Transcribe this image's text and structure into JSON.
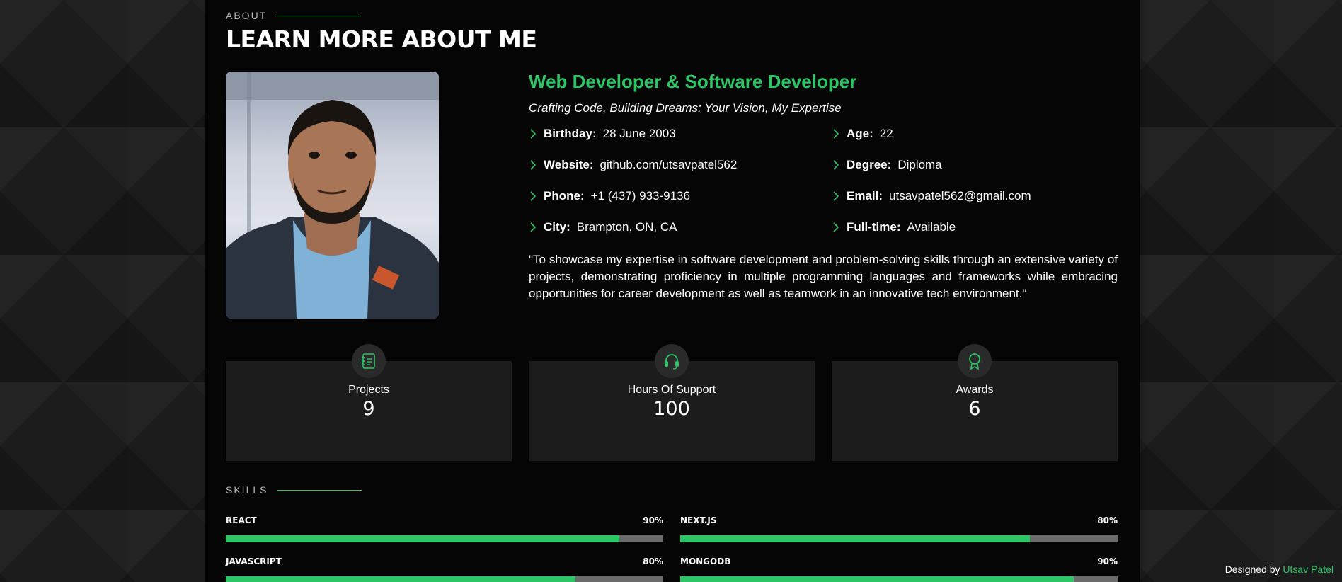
{
  "about": {
    "section_label": "ABOUT",
    "title": "LEARN MORE ABOUT ME"
  },
  "profile": {
    "role": "Web Developer & Software Developer",
    "tagline": "Crafting Code, Building Dreams: Your Vision, My Expertise",
    "details": [
      {
        "label": "Birthday:",
        "value": "28 June 2003"
      },
      {
        "label": "Age:",
        "value": "22"
      },
      {
        "label": "Website:",
        "value": "github.com/utsavpatel562"
      },
      {
        "label": "Degree:",
        "value": "Diploma"
      },
      {
        "label": "Phone:",
        "value": "+1 (437) 933-9136"
      },
      {
        "label": "Email:",
        "value": "utsavpatel562@gmail.com"
      },
      {
        "label": "City:",
        "value": "Brampton, ON, CA"
      },
      {
        "label": "Full-time:",
        "value": "Available"
      }
    ],
    "quote": "\"To showcase my expertise in software development and problem-solving skills through an extensive variety of projects, demonstrating proficiency in multiple programming languages and frameworks while embracing opportunities for career development as well as teamwork in an innovative tech environment.\""
  },
  "stats": [
    {
      "label": "Projects",
      "value": "9",
      "icon": "journal-icon"
    },
    {
      "label": "Hours Of Support",
      "value": "100",
      "icon": "headset-icon"
    },
    {
      "label": "Awards",
      "value": "6",
      "icon": "award-icon"
    }
  ],
  "skills": {
    "section_label": "SKILLS",
    "items": [
      {
        "name": "REACT",
        "percent_label": "90%",
        "level": 0.9
      },
      {
        "name": "NEXT.JS",
        "percent_label": "80%",
        "level": 0.8
      },
      {
        "name": "JAVASCRIPT",
        "percent_label": "80%",
        "level": 0.8
      },
      {
        "name": "MONGODB",
        "percent_label": "90%",
        "level": 0.9
      }
    ]
  },
  "footer": {
    "prefix": "Designed by",
    "author": "Utsav Patel"
  },
  "colors": {
    "accent": "#2dc565",
    "panel": "#050505",
    "card": "#1c1c1c",
    "track": "#6b6b6b"
  }
}
